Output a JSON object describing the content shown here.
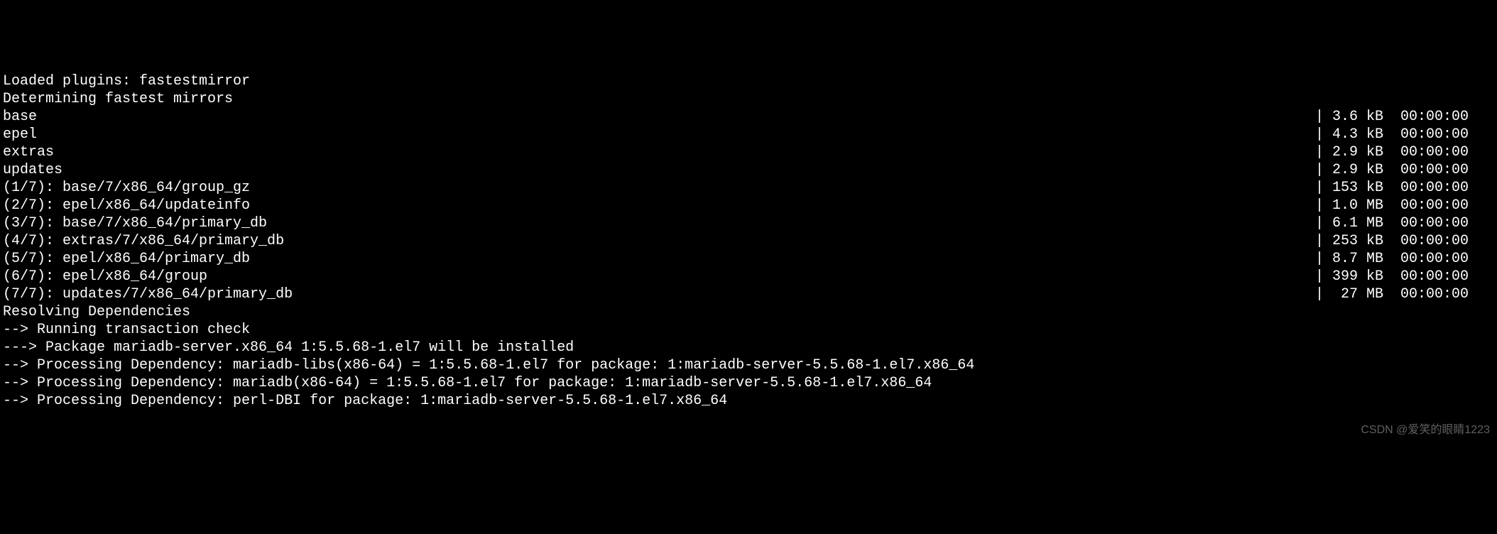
{
  "lines": {
    "plugins": "Loaded plugins: fastestmirror",
    "determining": "Determining fastest mirrors"
  },
  "repos": [
    {
      "name": "base",
      "size": "3.6 kB",
      "time": "00:00:00"
    },
    {
      "name": "epel",
      "size": "4.3 kB",
      "time": "00:00:00"
    },
    {
      "name": "extras",
      "size": "2.9 kB",
      "time": "00:00:00"
    },
    {
      "name": "updates",
      "size": "2.9 kB",
      "time": "00:00:00"
    }
  ],
  "downloads": [
    {
      "label": "(1/7): base/7/x86_64/group_gz",
      "size": "153 kB",
      "time": "00:00:00"
    },
    {
      "label": "(2/7): epel/x86_64/updateinfo",
      "size": "1.0 MB",
      "time": "00:00:00"
    },
    {
      "label": "(3/7): base/7/x86_64/primary_db",
      "size": "6.1 MB",
      "time": "00:00:00"
    },
    {
      "label": "(4/7): extras/7/x86_64/primary_db",
      "size": "253 kB",
      "time": "00:00:00"
    },
    {
      "label": "(5/7): epel/x86_64/primary_db",
      "size": "8.7 MB",
      "time": "00:00:00"
    },
    {
      "label": "(6/7): epel/x86_64/group",
      "size": "399 kB",
      "time": "00:00:00"
    },
    {
      "label": "(7/7): updates/7/x86_64/primary_db",
      "size": " 27 MB",
      "time": "00:00:00"
    }
  ],
  "resolving": {
    "header": "Resolving Dependencies",
    "check": "--> Running transaction check",
    "pkg": "---> Package mariadb-server.x86_64 1:5.5.68-1.el7 will be installed",
    "dep1": "--> Processing Dependency: mariadb-libs(x86-64) = 1:5.5.68-1.el7 for package: 1:mariadb-server-5.5.68-1.el7.x86_64",
    "dep2": "--> Processing Dependency: mariadb(x86-64) = 1:5.5.68-1.el7 for package: 1:mariadb-server-5.5.68-1.el7.x86_64",
    "dep3": "--> Processing Dependency: perl-DBI for package: 1:mariadb-server-5.5.68-1.el7.x86_64"
  },
  "watermark": "CSDN @爱笑的眼睛1223"
}
